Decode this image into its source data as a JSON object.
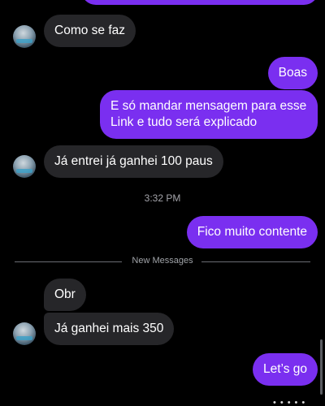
{
  "messages": [
    {
      "text": "Como se faz"
    },
    {
      "text": "Boas"
    },
    {
      "line1": "E só mandar mensagem para esse",
      "line2": "Link e tudo será explicado"
    },
    {
      "text": "Já entrei já ganhei 100 paus"
    },
    {
      "text": "Fico muito contente"
    },
    {
      "text": "Obr"
    },
    {
      "text": "Já ganhei mais 350"
    },
    {
      "text": "Let’s go"
    }
  ],
  "timestamp": "3:32 PM",
  "divider_label": "New Messages",
  "colors": {
    "background": "#000000",
    "incoming_bubble": "#262629",
    "outgoing_bubble": "#7a2ff0",
    "text": "#ffffff",
    "meta_text": "#a4a4aa"
  }
}
